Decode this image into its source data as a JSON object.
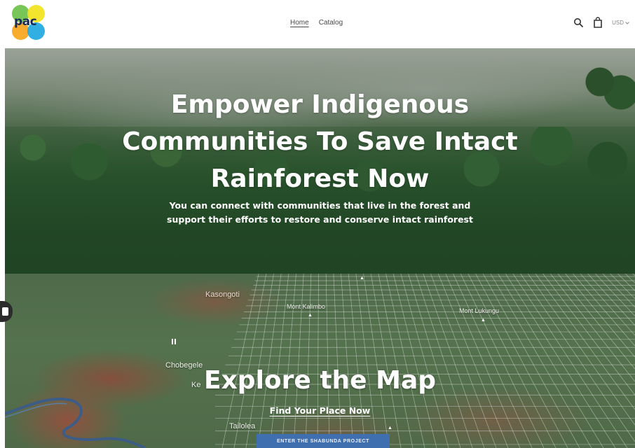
{
  "header": {
    "logo_text": "pac",
    "nav": [
      {
        "label": "Home",
        "active": true
      },
      {
        "label": "Catalog",
        "active": false
      }
    ],
    "icons": [
      "search-icon",
      "shopping-bag-icon"
    ],
    "currency": "USD"
  },
  "hero": {
    "title_lines": [
      "Empower Indigenous",
      "Communities To Save Intact",
      "Rainforest Now"
    ],
    "subtitle_lines": [
      "You can connect with communities that live in the forest and",
      "support their efforts to restore and conserve intact rainforest"
    ]
  },
  "map": {
    "labels": {
      "kasongo": "Kasongoti",
      "kalimbo": "Mont Kalimbo",
      "lukungu": "Mont Lukungu",
      "chobegele": "Chobegele",
      "ke": "Ke",
      "tailolea": "Tailolea"
    },
    "title": "Explore the Map",
    "link": "Find Your Place Now",
    "button": "ENTER THE SHABUNDA PROJECT"
  },
  "colors": {
    "button_blue": "#3f6fae",
    "logo_green": "#6cc04a",
    "logo_yellow": "#f2e21c",
    "logo_orange": "#f7a51c",
    "logo_blue": "#1fa8e1"
  }
}
